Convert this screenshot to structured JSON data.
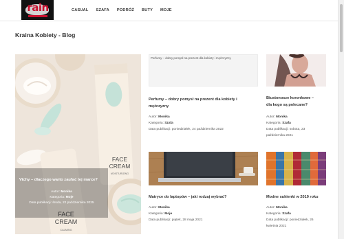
{
  "header": {
    "logo_text": "rain",
    "nav": [
      "CASUAL",
      "SZAFA",
      "PODRÓŻ",
      "BUTY",
      "MOJE"
    ]
  },
  "page_title": "Kraina Kobiety - Blog",
  "featured": {
    "title": "Vichy – dlaczego warto zaufać tej marce?",
    "author_label": "Autor:",
    "author": "Monika",
    "category_label": "Kategoria:",
    "category": "Moje",
    "date_label": "Data publikacji:",
    "date": "środa, 22 października 2025",
    "image_text": {
      "tube1_line1": "FACE",
      "tube1_line2": "CREAM",
      "tube1_line3": "MOISTURIZING",
      "tube2_line1": "FACE",
      "tube2_line2": "CREAM",
      "tube2_line3": "CALMING"
    }
  },
  "posts": [
    {
      "title_line1": "Perfumy – dobry pomysł na prezent dla kobiety i",
      "title_line2": "mężczyzny",
      "alt": "Perfumy – dobry pomysł na prezent dla kobiety i mężczyzny",
      "author_label": "Autor:",
      "author": "Monika",
      "category_label": "Kategoria:",
      "category": "Szafa",
      "date_label": "Data publikacji:",
      "date_line1": "poniedziałek, 24 października 2022",
      "date_line2": ""
    },
    {
      "title_line1": "Biustonosze koronkowe –",
      "title_line2": "dla kogo są polecane?",
      "author_label": "Autor:",
      "author": "Monika",
      "category_label": "Kategoria:",
      "category": "Szafa",
      "date_label": "Data publikacji:",
      "date_line1": "sobota, 23",
      "date_line2": "października 2021"
    },
    {
      "title_line1": "Matryce do laptopów – jaki rodzaj wybrać?",
      "title_line2": "",
      "author_label": "Autor:",
      "author": "Monika",
      "category_label": "Kategoria:",
      "category": "Moje",
      "date_label": "Data publikacji:",
      "date_line1": "piątek, 28 maja 2021",
      "date_line2": ""
    },
    {
      "title_line1": "Modne sukienki w 2019 roku",
      "title_line2": "",
      "author_label": "Autor:",
      "author": "Monika",
      "category_label": "Kategoria:",
      "category": "Szafa",
      "date_label": "Data publikacji:",
      "date_line1": "poniedziałek, 26",
      "date_line2": "kwietnia 2021"
    }
  ],
  "colors": {
    "brand_red": "#c8102e",
    "text": "#333333",
    "nav_text": "#333333"
  }
}
